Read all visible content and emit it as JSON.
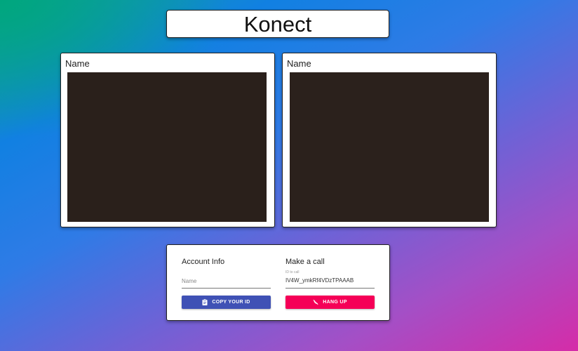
{
  "app": {
    "title": "Konect"
  },
  "videos": {
    "local": {
      "name": "Name"
    },
    "remote": {
      "name": "Name"
    }
  },
  "account": {
    "title": "Account Info",
    "name_placeholder": "Name",
    "copy_button_label": "COPY YOUR ID",
    "copy_icon": "clipboard-icon"
  },
  "call": {
    "title": "Make a call",
    "id_label": "ID to call",
    "id_value": "IV4W_ymkRf4VDzTPAAAB",
    "hangup_button_label": "HANG UP",
    "hangup_icon": "phone-off-icon"
  },
  "colors": {
    "copy_button": "#3f51b5",
    "hangup_button": "#f50057",
    "video_background": "#2a201b"
  }
}
